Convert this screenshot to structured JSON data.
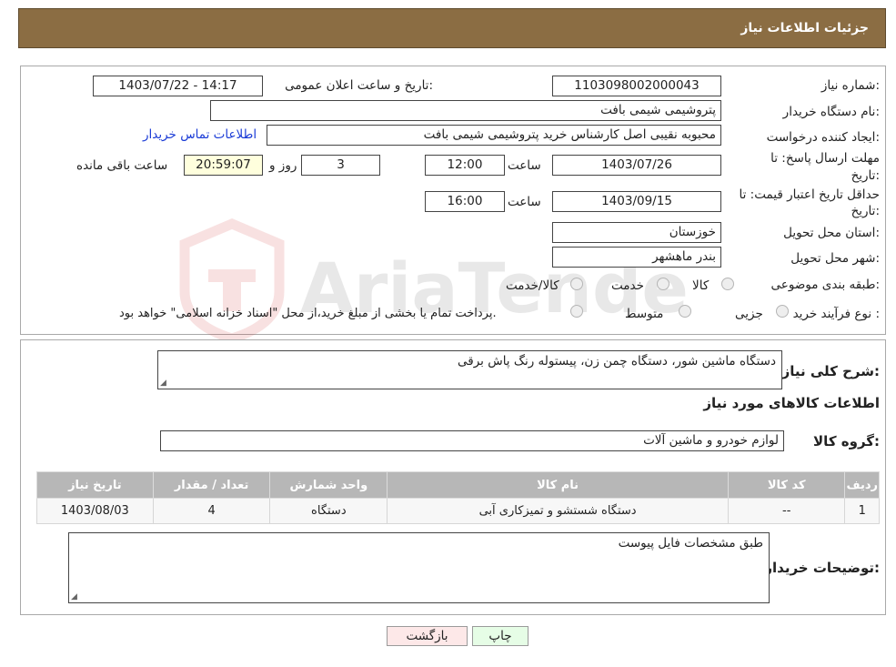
{
  "header": {
    "title": "جزئیات اطلاعات نیاز"
  },
  "fields": {
    "need_number_label": "شماره نیاز:",
    "need_number": "1103098002000043",
    "announce_label": "تاریخ و ساعت اعلان عمومی:",
    "announce_value": "1403/07/22 - 14:17",
    "buyer_org_label": "نام دستگاه خریدار:",
    "buyer_org": "پتروشیمی شیمی بافت",
    "creator_label": "ایجاد کننده درخواست:",
    "creator": "محبوبه نقیبی اصل کارشناس خرید پتروشیمی شیمی بافت",
    "contact_link": "اطلاعات تماس خریدار",
    "deadline_label_1": "مهلت ارسال پاسخ: تا",
    "deadline_label_2": "تاریخ:",
    "deadline_date": "1403/07/26",
    "time_label": "ساعت",
    "deadline_time": "12:00",
    "days": "3",
    "days_label": "روز و",
    "remaining": "20:59:07",
    "remaining_label": "ساعت باقی مانده",
    "validity_label_1": "حداقل تاریخ اعتبار قیمت: تا",
    "validity_label_2": "تاریخ:",
    "validity_date": "1403/09/15",
    "validity_time": "16:00",
    "province_label": "استان محل تحویل:",
    "province": "خوزستان",
    "city_label": "شهر محل تحویل:",
    "city": "بندر ماهشهر",
    "category_label": "طبقه بندی موضوعی:",
    "category_options": [
      "کالا",
      "خدمت",
      "کالا/خدمت"
    ],
    "process_label": "نوع فرآیند خرید :",
    "process_options": [
      "جزیی",
      "متوسط"
    ],
    "process_note": "پرداخت تمام یا بخشی از مبلغ خرید،از محل \"اسناد خزانه اسلامی\" خواهد بود."
  },
  "description": {
    "label": "شرح کلی نیاز:",
    "value": "دستگاه ماشین شور، دستگاه چمن زن، پیستوله رنگ پاش برقی"
  },
  "goods_section": {
    "title": "اطلاعات کالاهای مورد نیاز",
    "group_label": "گروه کالا:",
    "group_value": "لوازم خودرو و ماشین آلات"
  },
  "table": {
    "headers": [
      "ردیف",
      "کد کالا",
      "نام کالا",
      "واحد شمارش",
      "تعداد / مقدار",
      "تاریخ نیاز"
    ],
    "rows": [
      [
        "1",
        "--",
        "دستگاه شستشو و تمیزکاری آبی",
        "دستگاه",
        "4",
        "1403/08/03"
      ]
    ]
  },
  "buyer_notes": {
    "label": "توضیحات خریدار:",
    "value": "طبق مشخصات فایل پیوست"
  },
  "buttons": {
    "print": "چاپ",
    "back": "بازگشت"
  },
  "watermark": {
    "text": "AriaTender.neT"
  },
  "colors": {
    "header_bg": "#8b6d43",
    "back_button_bg": "#fde8e8",
    "print_button_bg": "#e6fde6",
    "remaining_bg": "#ffffdd",
    "link": "#1a3bd6"
  }
}
